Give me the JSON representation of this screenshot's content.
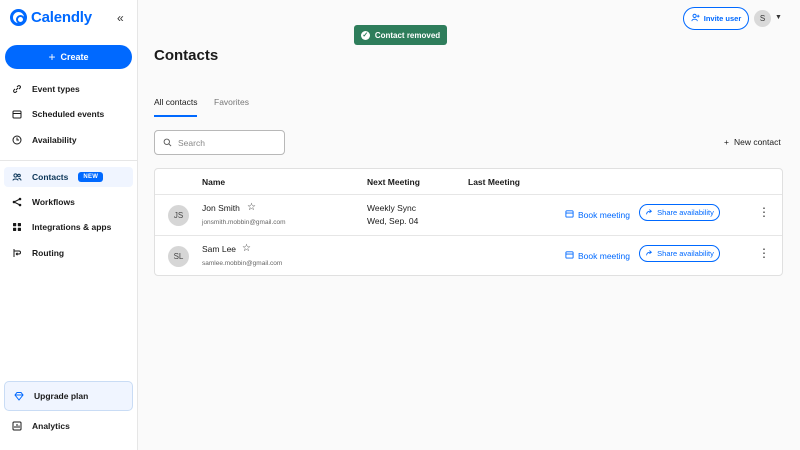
{
  "brand": {
    "name": "Calendly",
    "color": "#0069ff"
  },
  "sidebar": {
    "create_label": "Create",
    "items": [
      {
        "label": "Event types",
        "icon": "link-icon"
      },
      {
        "label": "Scheduled events",
        "icon": "calendar-icon"
      },
      {
        "label": "Availability",
        "icon": "clock-icon"
      },
      {
        "label": "Contacts",
        "icon": "contacts-icon",
        "badge": "NEW",
        "active": true
      },
      {
        "label": "Workflows",
        "icon": "workflow-icon"
      },
      {
        "label": "Integrations & apps",
        "icon": "grid-icon"
      },
      {
        "label": "Routing",
        "icon": "routing-icon"
      }
    ],
    "upgrade_label": "Upgrade plan",
    "bottom_items": [
      {
        "label": "Analytics",
        "icon": "analytics-icon"
      }
    ]
  },
  "toast": {
    "message": "Contact removed",
    "color": "#2e7d5b"
  },
  "header": {
    "invite_label": "Invite user",
    "avatar_initial": "S"
  },
  "page": {
    "title": "Contacts",
    "tabs": [
      {
        "label": "All contacts",
        "active": true
      },
      {
        "label": "Favorites",
        "active": false
      }
    ],
    "search_placeholder": "Search",
    "new_contact_label": "New contact"
  },
  "table": {
    "columns": [
      "Name",
      "Next Meeting",
      "Last Meeting"
    ],
    "rows": [
      {
        "initials": "JS",
        "name": "Jon Smith",
        "email": "jonsmith.mobbin@gmail.com",
        "next_meeting_title": "Weekly Sync",
        "next_meeting_date": "Wed, Sep. 04",
        "last_meeting": "",
        "book_label": "Book meeting",
        "share_label": "Share availability"
      },
      {
        "initials": "SL",
        "name": "Sam Lee",
        "email": "samlee.mobbin@gmail.com",
        "next_meeting_title": "",
        "next_meeting_date": "",
        "last_meeting": "",
        "book_label": "Book meeting",
        "share_label": "Share availability"
      }
    ]
  }
}
